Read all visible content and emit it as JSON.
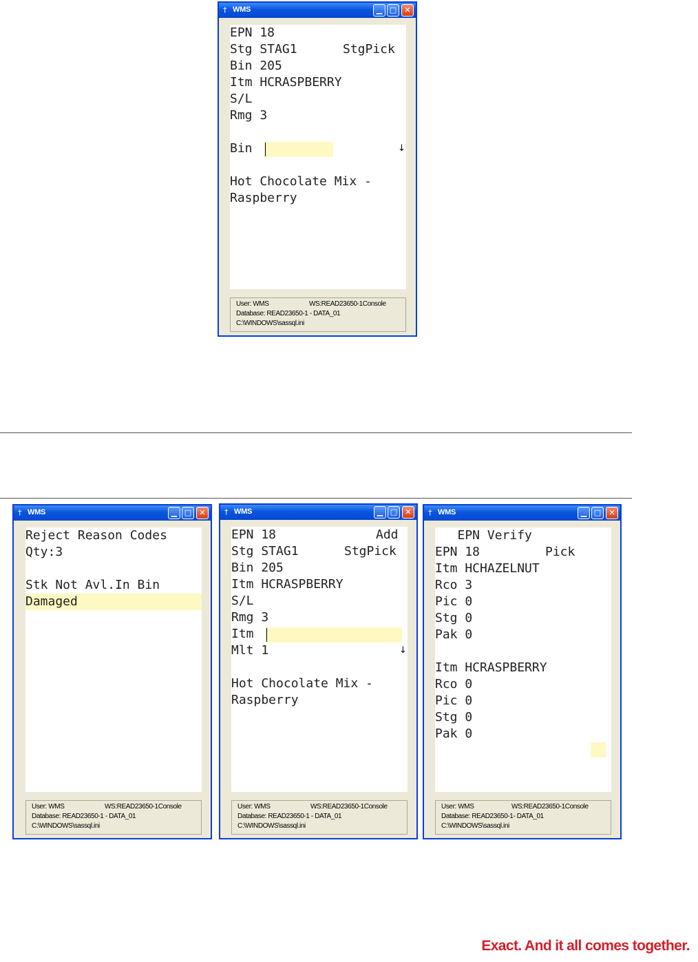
{
  "window_title": "WMS",
  "title_buttons": {
    "minimize": "▁",
    "maximize": "□",
    "close": "✕"
  },
  "icons": {
    "app": "†",
    "down_arrow": "↓"
  },
  "screens": {
    "top": {
      "lines": [
        "EPN 18",
        "Stg STAG1",
        "Bin 205",
        "Itm HCRASPBERRY",
        "S/L",
        "Rmg 3",
        "",
        "Bin",
        "",
        "Hot Chocolate Mix -",
        "Raspberry"
      ],
      "stg_right": "StgPick",
      "status": {
        "user": "User: WMS",
        "ws": "WS:READ23650-1Console",
        "database": "Database: READ23650-1 - DATA_01",
        "ini": "C:\\WINDOWS\\sassql.ini"
      }
    },
    "reject": {
      "lines": [
        "Reject Reason Codes",
        "Qty:3",
        "",
        "Stk Not Avl.In Bin",
        "Damaged"
      ],
      "status": {
        "user": "User: WMS",
        "ws": "WS:READ23650-1Console",
        "database": "Database: READ23650-1 - DATA_01",
        "ini": "C:\\WINDOWS\\sassql.ini"
      }
    },
    "add": {
      "lines": [
        "EPN 18",
        "Stg STAG1",
        "Bin 205",
        "Itm HCRASPBERRY",
        "S/L",
        "Rmg 3",
        "Itm",
        "Mlt 1",
        "",
        "Hot Chocolate Mix -",
        "Raspberry"
      ],
      "epn_right": "Add",
      "stg_right": "StgPick",
      "status": {
        "user": "User: WMS",
        "ws": "WS:READ23650-1Console",
        "database": "Database: READ23650-1 - DATA_01",
        "ini": "C:\\WINDOWS\\sassql.ini"
      }
    },
    "verify": {
      "lines": [
        "   EPN Verify",
        "EPN 18",
        "Itm HCHAZELNUT",
        "Rco 3",
        "Pic 0",
        "Stg 0",
        "Pak 0",
        "",
        "Itm HCRASPBERRY",
        "Rco 0",
        "Pic 0",
        "Stg 0",
        "Pak 0"
      ],
      "epn_right": "Pick",
      "status": {
        "user": "User: WMS",
        "ws": "WS:READ23650-1Console",
        "database": "Database: READ23650-1- DATA_01",
        "ini": "C:\\WINDOWS\\sassql.ini"
      }
    }
  },
  "tagline": "Exact. And it all comes together.",
  "colors": {
    "highlight": "#fef9c3",
    "titlebar": "#0a55e0",
    "tagline": "#d4202a"
  }
}
